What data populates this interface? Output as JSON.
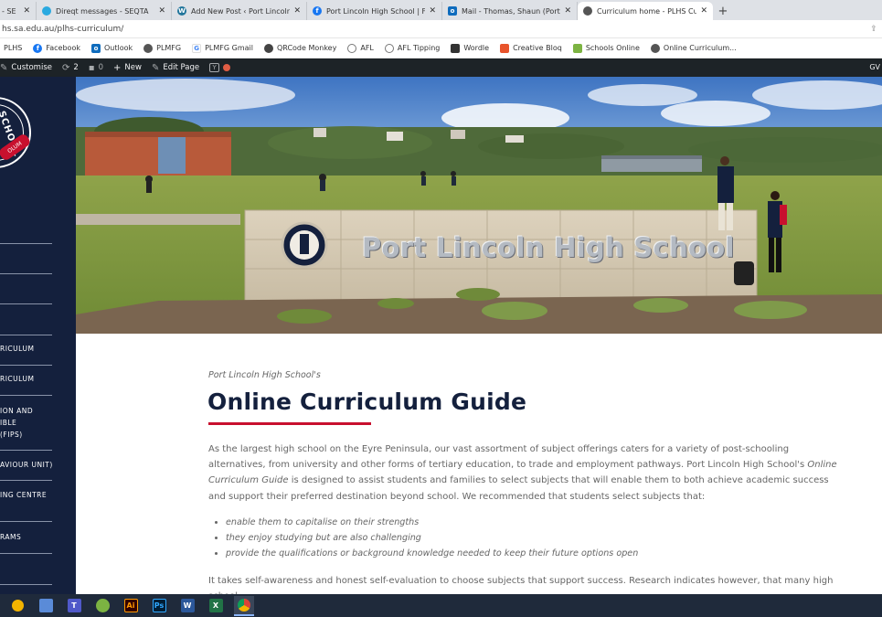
{
  "browser": {
    "tabs": [
      {
        "label": "- SE",
        "favicon_color": "#2e7d32",
        "active": false
      },
      {
        "label": "Direqt messages - SEQTA",
        "favicon_color": "#2aa9e0",
        "active": false
      },
      {
        "label": "Add New Post ‹ Port Lincoln Hig",
        "favicon_color": "#21759b",
        "active": false
      },
      {
        "label": "Port Lincoln High School | Faceb",
        "favicon_color": "#1877f2",
        "active": false
      },
      {
        "label": "Mail - Thomas, Shaun (Port Linc",
        "favicon_color": "#0f6cbd",
        "active": false
      },
      {
        "label": "Curriculum home - PLHS Curricu",
        "favicon_color": "#555555",
        "active": true
      }
    ],
    "url": "hs.sa.edu.au/plhs-curriculum/",
    "bookmarks": [
      {
        "label": "PLHS",
        "icon_color": ""
      },
      {
        "label": "Facebook",
        "icon_color": "#1877f2"
      },
      {
        "label": "Outlook",
        "icon_color": "#0f6cbd"
      },
      {
        "label": "PLMFG",
        "icon_color": "#555555"
      },
      {
        "label": "PLMFG Gmail",
        "icon_color": "#4285f4"
      },
      {
        "label": "QRCode Monkey",
        "icon_color": "#444444"
      },
      {
        "label": "AFL",
        "icon_color": "#555555"
      },
      {
        "label": "AFL Tipping",
        "icon_color": "#555555"
      },
      {
        "label": "Wordle",
        "icon_color": "#333333"
      },
      {
        "label": "Creative Bloq",
        "icon_color": "#e8542c"
      },
      {
        "label": "Schools Online",
        "icon_color": "#7cb342"
      },
      {
        "label": "Online Curriculum...",
        "icon_color": "#555555"
      }
    ]
  },
  "adminbar": {
    "customise": "Customise",
    "updates": "2",
    "comments": "0",
    "new": "New",
    "edit": "Edit Page",
    "right": "GV"
  },
  "sidebar": {
    "logo_text": "SCHOOL",
    "logo_band": "OLUM",
    "items": [
      "RICULUM",
      "RICULUM",
      "ION AND\nIBLE\n(FIPS)",
      "AVIOUR UNIT)",
      "ING CENTRE",
      "RAMS"
    ]
  },
  "hero": {
    "sign_text": "Port Lincoln High School"
  },
  "content": {
    "kicker": "Port Lincoln High School's",
    "title": "Online Curriculum Guide",
    "para_before": "As the largest high school on the Eyre Peninsula, our vast assortment of subject offerings caters for a variety of post-schooling alternatives, from university and other forms of tertiary education, to trade and employment pathways. Port Lincoln High School's ",
    "para_em": "Online Curriculum Guide",
    "para_after": " is designed to assist students and families to select subjects that will enable them to both achieve academic success and support their preferred destination beyond school. We recommended that students select subjects that:",
    "bullets": [
      "enable them to capitalise on their strengths",
      "they enjoy studying but are also challenging",
      "provide the qualifications or background knowledge needed to keep their future options open"
    ],
    "para2": "It takes self-awareness and honest self-evaluation to choose subjects that support success. Research indicates however, that many high school"
  },
  "taskbar": {
    "apps": [
      {
        "name": "ie",
        "label": "",
        "color": "#f4b400"
      },
      {
        "name": "folder",
        "label": "",
        "color": "#5a8bd8"
      },
      {
        "name": "teams",
        "label": "T",
        "color": "#5059c9"
      },
      {
        "name": "globe",
        "label": "",
        "color": "#7cb342"
      },
      {
        "name": "illustrator",
        "label": "Ai",
        "color": "#330000"
      },
      {
        "name": "photoshop",
        "label": "Ps",
        "color": "#001e36"
      },
      {
        "name": "word",
        "label": "W",
        "color": "#2b579a"
      },
      {
        "name": "excel",
        "label": "X",
        "color": "#217346"
      },
      {
        "name": "chrome",
        "label": "",
        "color": "#db4437"
      }
    ]
  }
}
